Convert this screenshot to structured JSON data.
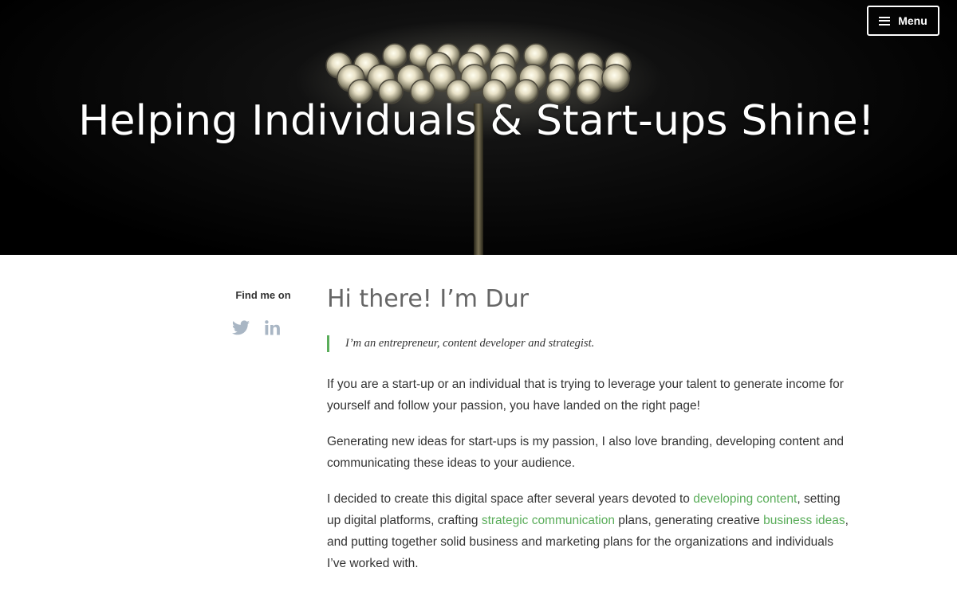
{
  "header": {
    "menu_label": "Menu",
    "hero_title": "Helping Individuals & Start-ups Shine!"
  },
  "sidebar": {
    "find_me_label": "Find me on",
    "social": [
      {
        "icon": "twitter-icon"
      },
      {
        "icon": "linkedin-icon"
      }
    ]
  },
  "main": {
    "heading": "Hi there! I’m Dur",
    "quote": "I’m an entrepreneur, content developer and strategist.",
    "paragraph1": "If you are a start-up or an individual that is trying to leverage your talent to generate income for yourself and follow your passion, you have landed on the right page!",
    "paragraph2": "Generating new ideas for start-ups is my passion, I also love branding, developing content and communicating these ideas to your audience.",
    "paragraph3": {
      "t1": "I decided to create this digital space after several years devoted to ",
      "link1": "developing content",
      "t2": ", setting up digital platforms, crafting ",
      "link2": "strategic communication",
      "t3": " plans, generating creative ",
      "link3": "business ideas",
      "t4": ", and putting together solid business and marketing plans for the organizations and individuals I’ve worked with."
    }
  },
  "colors": {
    "accent_green": "#5aad5a",
    "text": "#333333",
    "heading_gray": "#666666",
    "icon_gray": "#a9b6c4"
  }
}
